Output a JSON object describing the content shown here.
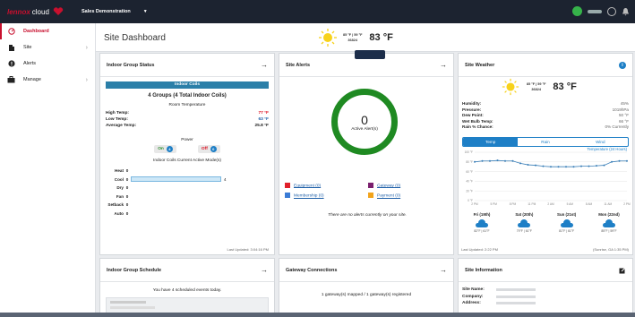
{
  "topbar": {
    "brand_prefix": "lennox",
    "brand_name": "cloud",
    "project": "Sales Demonstration",
    "project_caret": "▼"
  },
  "sidebar": {
    "items": [
      {
        "label": "Dashboard",
        "icon": "dashboard-icon"
      },
      {
        "label": "Site",
        "icon": "building-icon"
      },
      {
        "label": "Alerts",
        "icon": "alert-icon"
      },
      {
        "label": "Manage",
        "icon": "briefcase-icon"
      }
    ]
  },
  "page": {
    "title": "Site Dashboard"
  },
  "header_weather": {
    "hilo": "85 °F | 59 °F",
    "zip": "36824",
    "temp": "83 °F"
  },
  "indoor_status": {
    "title": "Indoor Group Status",
    "bar_label": "Indoor Coils",
    "groups": "4 Groups (4 Total Indoor Coils)",
    "room_temp_label": "Room Temperature",
    "rows": [
      {
        "label": "High Temp:",
        "value": "77 °F"
      },
      {
        "label": "Low Temp:",
        "value": "63 °F"
      },
      {
        "label": "Average Temp:",
        "value": "25.8 °F"
      }
    ],
    "power_label": "Power",
    "on_label": "On",
    "on_count": "4",
    "off_label": "Off",
    "off_count": "0",
    "modes_title": "Indoor Coils Current Active Mode(s)",
    "modes": [
      {
        "label": "Heat",
        "count": "0",
        "fraction": 0
      },
      {
        "label": "Cool",
        "count": "0",
        "fraction": 1,
        "end_label": "4"
      },
      {
        "label": "Dry",
        "count": "0",
        "fraction": 0
      },
      {
        "label": "Fan",
        "count": "0",
        "fraction": 0
      },
      {
        "label": "Setback",
        "count": "0",
        "fraction": 0
      },
      {
        "label": "Auto",
        "count": "0",
        "fraction": 0
      }
    ],
    "updated": "Last Updated: 3:04:16 PM"
  },
  "site_alerts": {
    "title": "Site Alerts",
    "count": "0",
    "count_label": "Active Alert(s)",
    "legend": [
      {
        "label": "Equipment (0)",
        "color": "#e0202a"
      },
      {
        "label": "Gateway (0)",
        "color": "#7a1f6e"
      },
      {
        "label": "Membership (0)",
        "color": "#3a7bd5"
      },
      {
        "label": "Payment (0)",
        "color": "#f2a41c"
      }
    ],
    "empty_msg": "There are no alerts currently on your site."
  },
  "site_weather": {
    "title": "Site Weather",
    "info": "i",
    "hilo": "85 °F | 59 °F",
    "zip": "36824",
    "temp": "83 °F",
    "rows": [
      {
        "label": "Humidity:",
        "value": "45%"
      },
      {
        "label": "Pressure:",
        "value": "1019hPa"
      },
      {
        "label": "Dew Point:",
        "value": "50 °F"
      },
      {
        "label": "Wet Bulb Temp:",
        "value": "66 °F"
      },
      {
        "label": "Rain % Chance:",
        "value": "0% Currently"
      }
    ],
    "tabs": [
      "Temp",
      "Rain",
      "Wind"
    ],
    "chart_title": "Temperature (24 Hours)",
    "updated": "Last Updated: 2:22 PM",
    "sunrise": "(Sunrise, GA 1:35 PM)"
  },
  "chart_data": {
    "type": "line",
    "title": "Temperature (24 Hours)",
    "xlabel": "",
    "ylabel": "",
    "ylim": [
      0,
      100
    ],
    "y_ticks": [
      "0 °F",
      "20 °F",
      "40 °F",
      "60 °F",
      "80 °F",
      "100 °F"
    ],
    "x_ticks": [
      "2 PM",
      "5 PM",
      "8 PM",
      "11 PM",
      "2 AM",
      "5 AM",
      "8 AM",
      "11 AM",
      "2 PM"
    ],
    "series": [
      {
        "values": [
          80,
          82,
          82,
          83,
          82,
          82,
          77,
          74,
          73,
          71,
          70,
          70,
          70,
          70,
          71,
          71,
          72,
          73,
          80,
          82,
          82
        ]
      }
    ],
    "forecast": [
      {
        "day": "Fri (19th)",
        "range": "82°F | 61°F"
      },
      {
        "day": "Sat (20th)",
        "range": "79°F | 61°F"
      },
      {
        "day": "Sun (21st)",
        "range": "81°F | 61°F"
      },
      {
        "day": "Mon (22nd)",
        "range": "85°F | 59°F"
      }
    ]
  },
  "schedule": {
    "title": "Indoor Group Schedule",
    "summary": "You have 4 scheduled events today."
  },
  "gateway": {
    "title": "Gateway Connections",
    "summary": "1 gateway(s) mapped / 1 gateway(s) registered"
  },
  "site_info": {
    "title": "Site Information",
    "rows": [
      {
        "label": "Site Name:"
      },
      {
        "label": "Company:"
      },
      {
        "label": "Address:"
      }
    ]
  }
}
